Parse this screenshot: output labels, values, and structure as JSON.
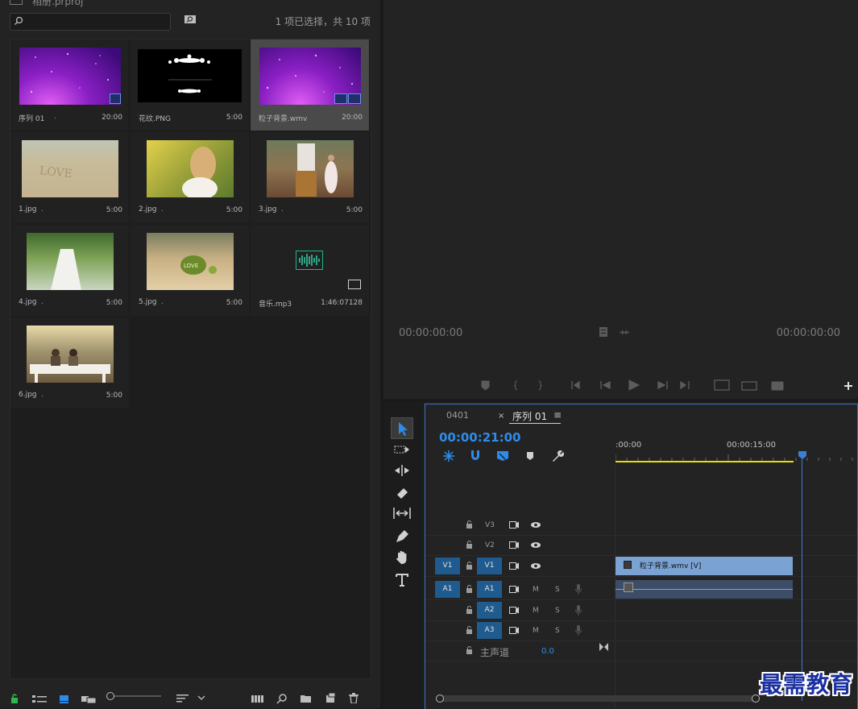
{
  "project": {
    "title": "相册.prproj",
    "selection_count": "1 项已选择，共 10 项",
    "items": [
      {
        "name": "序列 01",
        "dot": ".",
        "duration": "20:00"
      },
      {
        "name": "花纹.PNG",
        "dot": "",
        "duration": "5:00"
      },
      {
        "name": "粒子背景.wmv",
        "dot": "",
        "duration": "20:00"
      },
      {
        "name": "1.jpg",
        "dot": ".",
        "duration": "5:00"
      },
      {
        "name": "2.jpg",
        "dot": ".",
        "duration": "5:00"
      },
      {
        "name": "3.jpg",
        "dot": ".",
        "duration": "5:00"
      },
      {
        "name": "4.jpg",
        "dot": ".",
        "duration": "5:00"
      },
      {
        "name": "5.jpg",
        "dot": ".",
        "duration": "5:00"
      },
      {
        "name": "音乐.mp3",
        "dot": "",
        "duration": "1:46:07128"
      },
      {
        "name": "6.jpg",
        "dot": ".",
        "duration": "5:00"
      }
    ]
  },
  "monitor": {
    "timecode_left": "00:00:00:00",
    "timecode_right": "00:00:00:00"
  },
  "timeline": {
    "tabs": [
      {
        "label": "0401"
      },
      {
        "label": "序列 01",
        "close": "×",
        "menu": "≡"
      }
    ],
    "timecode": "00:00:21:00",
    "ruler": {
      "start": ":00:00",
      "mark": "00:00:15:00"
    },
    "tracks": {
      "v3": "V3",
      "v2": "V2",
      "v1": "V1",
      "v1_src": "V1",
      "a1": "A1",
      "a1_src": "A1",
      "a2": "A2",
      "a3": "A3",
      "m": "M",
      "s": "S"
    },
    "master": {
      "label": "主声道",
      "value": "0.0"
    },
    "clip_label": "粒子背景.wmv [V]"
  },
  "watermark": "最需教育",
  "colors": {
    "accent": "#2d8ceb",
    "playhead": "#3b7fd4",
    "clip": "#7aa3d4",
    "work_area": "#e8e000"
  }
}
